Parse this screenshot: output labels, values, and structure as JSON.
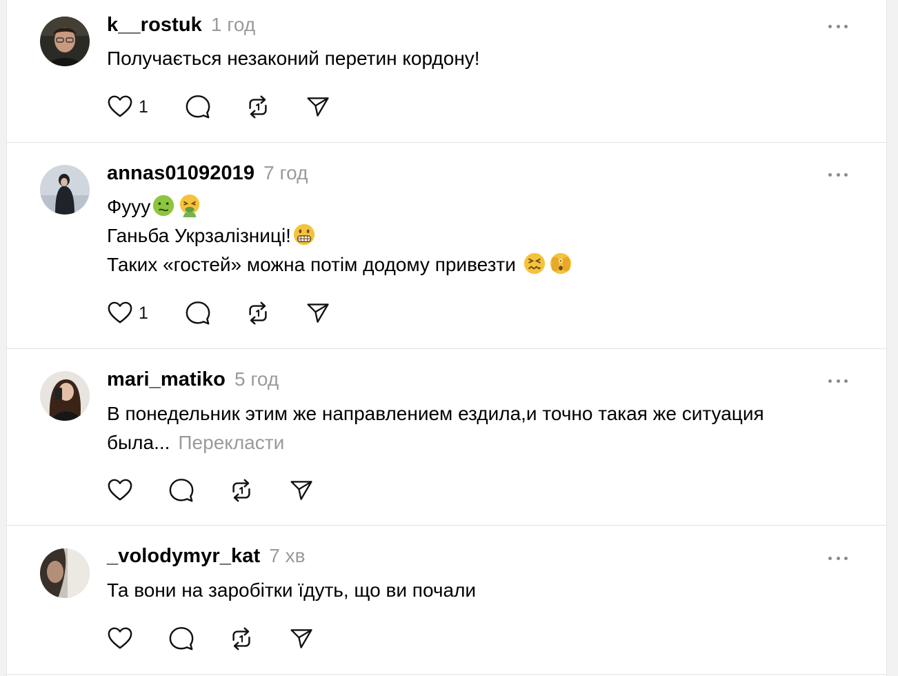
{
  "posts": [
    {
      "username": "k__rostuk",
      "time": "1 год",
      "lines": [
        "Получається незаконий перетин кордону!"
      ],
      "likes": "1"
    },
    {
      "username": "annas01092019",
      "time": "7 год",
      "lines": [
        "Фууу",
        "Ганьба Укрзалізниці!",
        "Таких «гостей» можна потім додому привезти"
      ],
      "emojis": [
        "nauseated-face",
        "vomiting-face",
        "grimacing-face",
        "confounded-face",
        "face-with-peeking-eye"
      ],
      "likes": "1"
    },
    {
      "username": "mari_matiko",
      "time": "5 год",
      "lines": [
        "В понедельник этим же направлением ездила,и точно такая же ситуация",
        "была..."
      ],
      "translate": "Перекласти",
      "likes": ""
    },
    {
      "username": "_volodymyr_kat",
      "time": "7 хв",
      "lines": [
        "Та вони на заробітки їдуть, що ви почали"
      ],
      "likes": ""
    }
  ],
  "icons": {
    "like": "heart-icon",
    "reply": "comment-icon",
    "repost": "repost-icon",
    "share": "share-icon",
    "more": "more-icon"
  },
  "colors": {
    "muted": "#9a9a9a",
    "divider": "#e2e2e2",
    "background": "#f2f2f2"
  }
}
